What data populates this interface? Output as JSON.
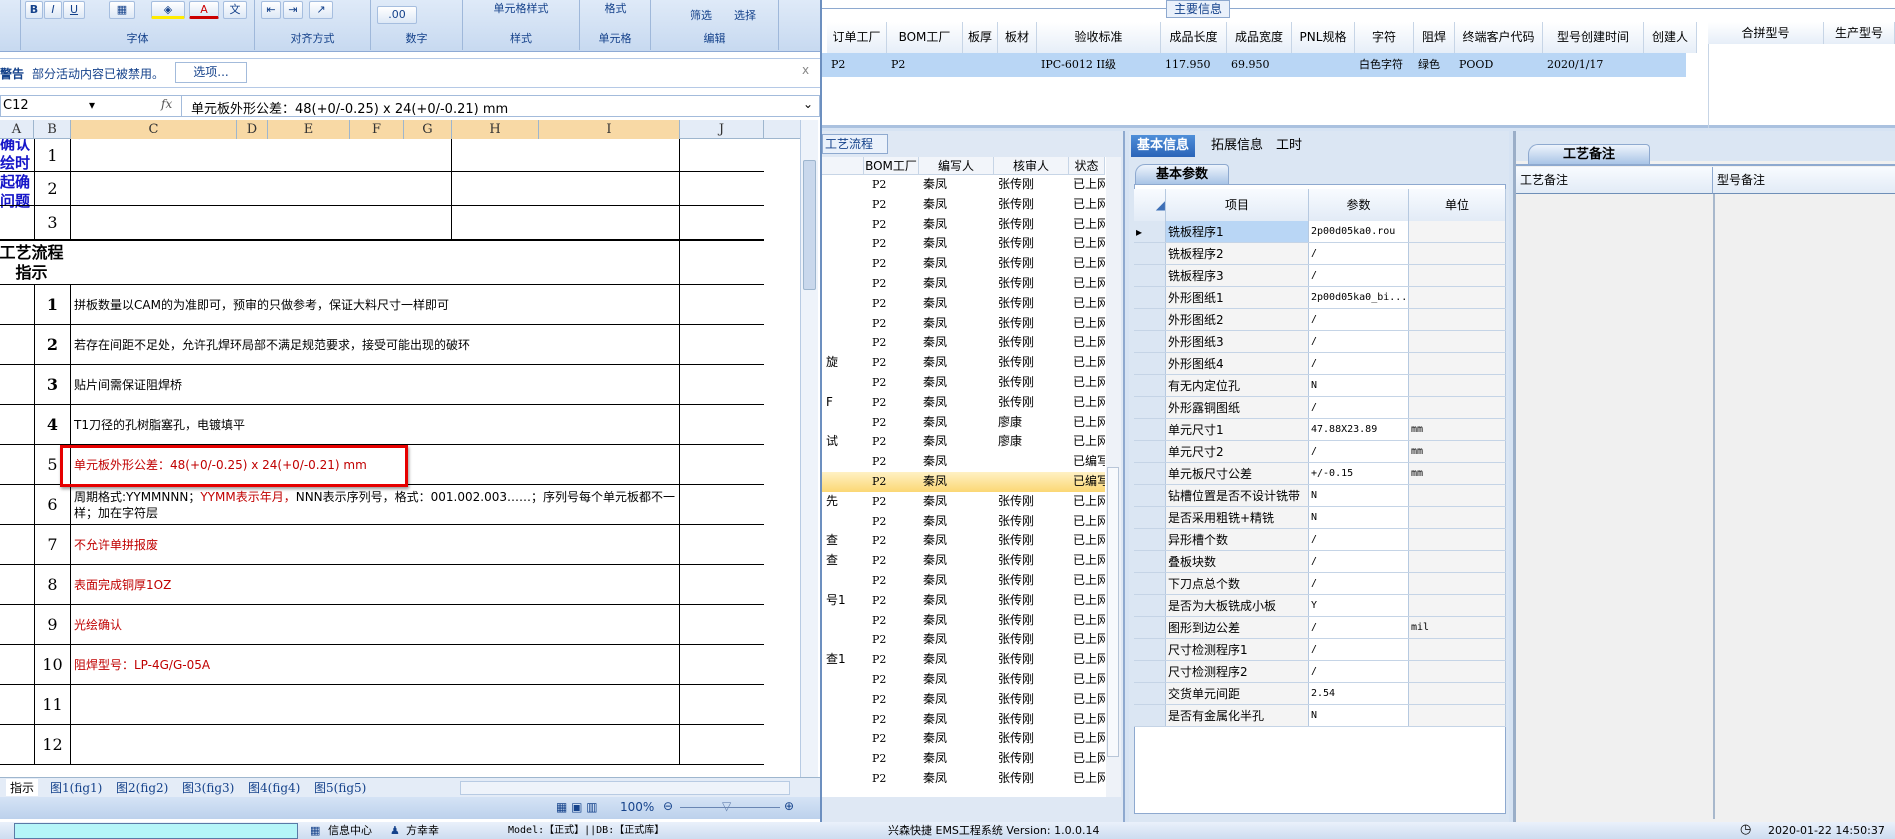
{
  "excel": {
    "ribbon": {
      "groups": [
        "字体",
        "对齐方式",
        "数字",
        "样式",
        "单元格",
        "编辑"
      ],
      "buttons": {
        "bold": "B",
        "italic": "I",
        "underline": "U",
        "font_color": "A",
        "phonetic": "文",
        "cell_styles": "单元格样式",
        "format": "格式",
        "filter": "筛选",
        "select": "选择",
        "dec_inc": ".00",
        "dec_dec": ".0"
      }
    },
    "security_bar": {
      "title": "警告",
      "message": "部分活动内容已被禁用。",
      "options_button": "选项...",
      "close": "x"
    },
    "formula_bar": {
      "name_box": "C12",
      "fx": "fx",
      "formula": "单元板外形公差：48(+0/-0.25) x 24(+0/-0.21) mm"
    },
    "columns": [
      "A",
      "B",
      "C",
      "D",
      "E",
      "F",
      "G",
      "H",
      "I",
      "J"
    ],
    "side_label_top": "确认\n绘时\n起确\n问题",
    "side_label_process": "工艺流程\n指示",
    "confirm_rows": [
      "1",
      "2",
      "3"
    ],
    "instructions": [
      {
        "no": "1",
        "text": "拼板数量以CAM的为准即可，预审的只做参考，保证大料尺寸一样即可",
        "red": false
      },
      {
        "no": "2",
        "text": "若存在间距不足处，允许孔焊环局部不满足规范要求，接受可能出现的破环",
        "red": false
      },
      {
        "no": "3",
        "text": "贴片间需保证阻焊桥",
        "red": false
      },
      {
        "no": "4",
        "text": "T1刀径的孔树脂塞孔，电镀填平",
        "red": false
      },
      {
        "no": "5",
        "text": "单元板外形公差：48(+0/-0.25) x 24(+0/-0.21) mm",
        "red": true
      },
      {
        "no": "6",
        "text": "周期格式:YYMMNNN；",
        "text_red": "YYMM表示年月，",
        "text_after": "NNN表示序列号，格式：001.002.003……；序列号每个单元板都不一样；加在字符层",
        "red": false
      },
      {
        "no": "7",
        "text": "不允许单拼报废",
        "red": true
      },
      {
        "no": "8",
        "text": "表面完成铜厚1OZ",
        "red": true
      },
      {
        "no": "9",
        "text": "光绘确认",
        "red": true
      },
      {
        "no": "10",
        "text": "阻焊型号：LP-4G/G-05A",
        "red": true
      },
      {
        "no": "11",
        "text": "",
        "red": false
      },
      {
        "no": "12",
        "text": "",
        "red": false
      }
    ],
    "sheet_tabs": [
      "指示",
      "图1(fig1)",
      "图2(fig2)",
      "图3(fig3)",
      "图4(fig4)",
      "图5(fig5)"
    ],
    "zoom": "100%",
    "zoom_value_percent": 100
  },
  "main_info": {
    "title": "主要信息",
    "headers": [
      "订单工厂",
      "BOM工厂",
      "板厚",
      "板材",
      "验收标准",
      "成品长度",
      "成品宽度",
      "PNL规格",
      "字符",
      "阻焊",
      "终端客户代码",
      "型号创建时间",
      "创建人"
    ],
    "row": [
      "P2",
      "P2",
      "",
      "",
      "IPC-6012 II级",
      "117.950",
      "69.950",
      "",
      "白色字符",
      "绿色",
      "POOD",
      "2020/1/17",
      ""
    ],
    "side_headers": [
      "合拼型号",
      "生产型号"
    ]
  },
  "process": {
    "tab": "工艺流程",
    "headers": [
      "",
      "BOM工厂",
      "编写人",
      "核审人",
      "状态"
    ],
    "rows": [
      [
        "",
        "P2",
        "秦凤",
        "张传刚",
        "已上网"
      ],
      [
        "",
        "P2",
        "秦凤",
        "张传刚",
        "已上网"
      ],
      [
        "",
        "P2",
        "秦凤",
        "张传刚",
        "已上网"
      ],
      [
        "",
        "P2",
        "秦凤",
        "张传刚",
        "已上网"
      ],
      [
        "",
        "P2",
        "秦凤",
        "张传刚",
        "已上网"
      ],
      [
        "",
        "P2",
        "秦凤",
        "张传刚",
        "已上网"
      ],
      [
        "",
        "P2",
        "秦凤",
        "张传刚",
        "已上网"
      ],
      [
        "",
        "P2",
        "秦凤",
        "张传刚",
        "已上网"
      ],
      [
        "",
        "P2",
        "秦凤",
        "张传刚",
        "已上网"
      ],
      [
        "旋",
        "P2",
        "秦凤",
        "张传刚",
        "已上网"
      ],
      [
        "",
        "P2",
        "秦凤",
        "张传刚",
        "已上网"
      ],
      [
        "F",
        "P2",
        "秦凤",
        "张传刚",
        "已上网"
      ],
      [
        "",
        "P2",
        "秦凤",
        "廖康",
        "已上网"
      ],
      [
        "试",
        "P2",
        "秦凤",
        "廖康",
        "已上网"
      ],
      [
        "",
        "P2",
        "秦凤",
        "",
        "已编写"
      ],
      [
        "",
        "P2",
        "秦凤",
        "",
        "已编写"
      ],
      [
        "先",
        "P2",
        "秦凤",
        "张传刚",
        "已上网"
      ],
      [
        "",
        "P2",
        "秦凤",
        "张传刚",
        "已上网"
      ],
      [
        "查",
        "P2",
        "秦凤",
        "张传刚",
        "已上网"
      ],
      [
        "查",
        "P2",
        "秦凤",
        "张传刚",
        "已上网"
      ],
      [
        "",
        "P2",
        "秦凤",
        "张传刚",
        "已上网"
      ],
      [
        "号1",
        "P2",
        "秦凤",
        "张传刚",
        "已上网"
      ],
      [
        "",
        "P2",
        "秦凤",
        "张传刚",
        "已上网"
      ],
      [
        "",
        "P2",
        "秦凤",
        "张传刚",
        "已上网"
      ],
      [
        "查1",
        "P2",
        "秦凤",
        "张传刚",
        "已上网"
      ],
      [
        "",
        "P2",
        "秦凤",
        "张传刚",
        "已上网"
      ],
      [
        "",
        "P2",
        "秦凤",
        "张传刚",
        "已上网"
      ],
      [
        "",
        "P2",
        "秦凤",
        "张传刚",
        "已上网"
      ],
      [
        "",
        "P2",
        "秦凤",
        "张传刚",
        "已上网"
      ],
      [
        "",
        "P2",
        "秦凤",
        "张传刚",
        "已上网"
      ],
      [
        "",
        "P2",
        "秦凤",
        "张传刚",
        "已上网"
      ]
    ],
    "selected_index": 15
  },
  "basic": {
    "tabs": [
      "基本信息",
      "拓展信息",
      "工时"
    ],
    "subtab": "基本参数",
    "headers": [
      "项目",
      "参数",
      "单位"
    ],
    "rows": [
      [
        "铣板程序1",
        "2p00d05ka0.rou",
        ""
      ],
      [
        "铣板程序2",
        "/",
        ""
      ],
      [
        "铣板程序3",
        "/",
        ""
      ],
      [
        "外形图纸1",
        "2p00d05ka0_bi...",
        ""
      ],
      [
        "外形图纸2",
        "/",
        ""
      ],
      [
        "外形图纸3",
        "/",
        ""
      ],
      [
        "外形图纸4",
        "/",
        ""
      ],
      [
        "有无内定位孔",
        "N",
        ""
      ],
      [
        "外形露铜图纸",
        "/",
        ""
      ],
      [
        "单元尺寸1",
        "47.88X23.89",
        "mm"
      ],
      [
        "单元尺寸2",
        "/",
        "mm"
      ],
      [
        "单元板尺寸公差",
        "+/-0.15",
        "mm"
      ],
      [
        "钻槽位置是否不设计铣带",
        "N",
        ""
      ],
      [
        "是否采用粗铣+精铣",
        "N",
        ""
      ],
      [
        "异形槽个数",
        "/",
        ""
      ],
      [
        "叠板块数",
        "/",
        ""
      ],
      [
        "下刀点总个数",
        "/",
        ""
      ],
      [
        "是否为大板铣成小板",
        "Y",
        ""
      ],
      [
        "图形到边公差",
        "/",
        "mil"
      ],
      [
        "尺寸检测程序1",
        "/",
        ""
      ],
      [
        "尺寸检测程序2",
        "/",
        ""
      ],
      [
        "交货单元间距",
        "2.54",
        ""
      ],
      [
        "是否有金属化半孔",
        "N",
        ""
      ]
    ]
  },
  "remarks": {
    "tab": "工艺备注",
    "headers": [
      "工艺备注",
      "型号备注"
    ]
  },
  "statusbar": {
    "info_center": "信息中心",
    "user": "方幸幸",
    "env": "Model:【正式】||DB:【正式库】",
    "system": "兴森快捷 EMS工程系统 Version: 1.0.0.14",
    "datetime": "2020-01-22 14:50:37"
  },
  "colors": {
    "highlight_box": "#e60000",
    "accent": "#2a64b8",
    "selected_row": "#fbd774"
  }
}
